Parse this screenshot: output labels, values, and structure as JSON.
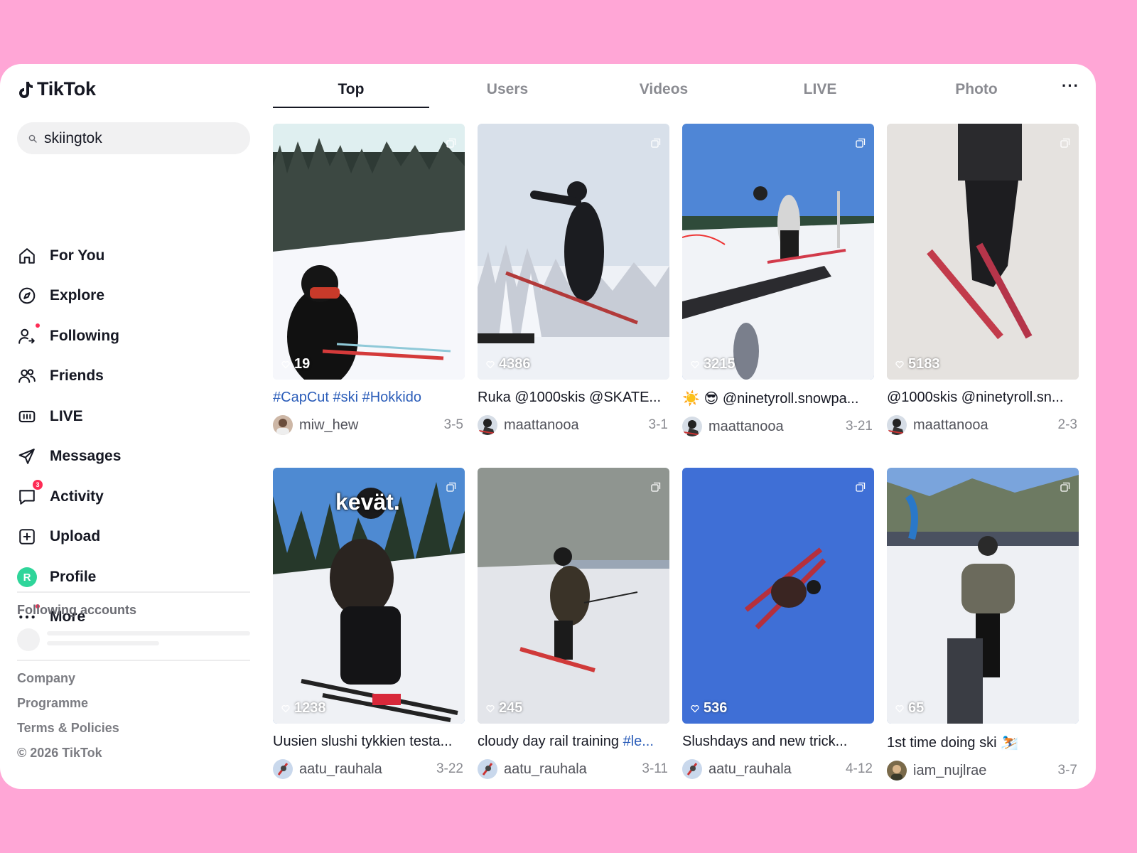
{
  "app": {
    "name": "TikTok"
  },
  "search": {
    "value": "skiingtok"
  },
  "nav": [
    {
      "label": "For You",
      "icon": "home-icon"
    },
    {
      "label": "Explore",
      "icon": "compass-icon"
    },
    {
      "label": "Following",
      "icon": "following-icon",
      "dot": true
    },
    {
      "label": "Friends",
      "icon": "friends-icon"
    },
    {
      "label": "LIVE",
      "icon": "live-icon"
    },
    {
      "label": "Messages",
      "icon": "send-icon"
    },
    {
      "label": "Activity",
      "icon": "activity-icon",
      "badge": "3"
    },
    {
      "label": "Upload",
      "icon": "upload-icon"
    },
    {
      "label": "Profile",
      "icon": "avatar",
      "avatar_letter": "R"
    },
    {
      "label": "More",
      "icon": "more-icon",
      "dot": true
    }
  ],
  "following": {
    "title": "Following accounts"
  },
  "footer": {
    "company": "Company",
    "programme": "Programme",
    "terms": "Terms & Policies",
    "copyright": "© 2026 TikTok"
  },
  "tabs": [
    {
      "label": "Top",
      "active": true
    },
    {
      "label": "Users"
    },
    {
      "label": "Videos"
    },
    {
      "label": "LIVE"
    },
    {
      "label": "Photo"
    }
  ],
  "tab_more": "···",
  "results": [
    {
      "likes": "19",
      "caption": "#CapCut #ski #Hokkido",
      "caption_is_tag": true,
      "author": "miw_hew",
      "date": "3-5"
    },
    {
      "likes": "4386",
      "caption": "Ruka @1000skis @SKATE...",
      "author": "maattanooa",
      "date": "3-1"
    },
    {
      "likes": "3215",
      "caption": "☀️ 😎  @ninetyroll.snowpa...",
      "author": "maattanooa",
      "date": "3-21"
    },
    {
      "likes": "5183",
      "caption": "@1000skis @ninetyroll.sn...",
      "author": "maattanooa",
      "date": "2-3"
    },
    {
      "likes": "1238",
      "caption": "Uusien slushi tykkien testa...",
      "overlay": "kevät.",
      "author": "aatu_rauhala",
      "date": "3-22"
    },
    {
      "likes": "245",
      "caption": "cloudy day rail training ",
      "caption_tag": "#le...",
      "author": "aatu_rauhala",
      "date": "3-11"
    },
    {
      "likes": "536",
      "caption": "Slushdays and new trick...",
      "author": "aatu_rauhala",
      "date": "4-12"
    },
    {
      "likes": "65",
      "caption": "1st time doing ski ⛷️",
      "author": "iam_nujlrae",
      "date": "3-7"
    }
  ]
}
